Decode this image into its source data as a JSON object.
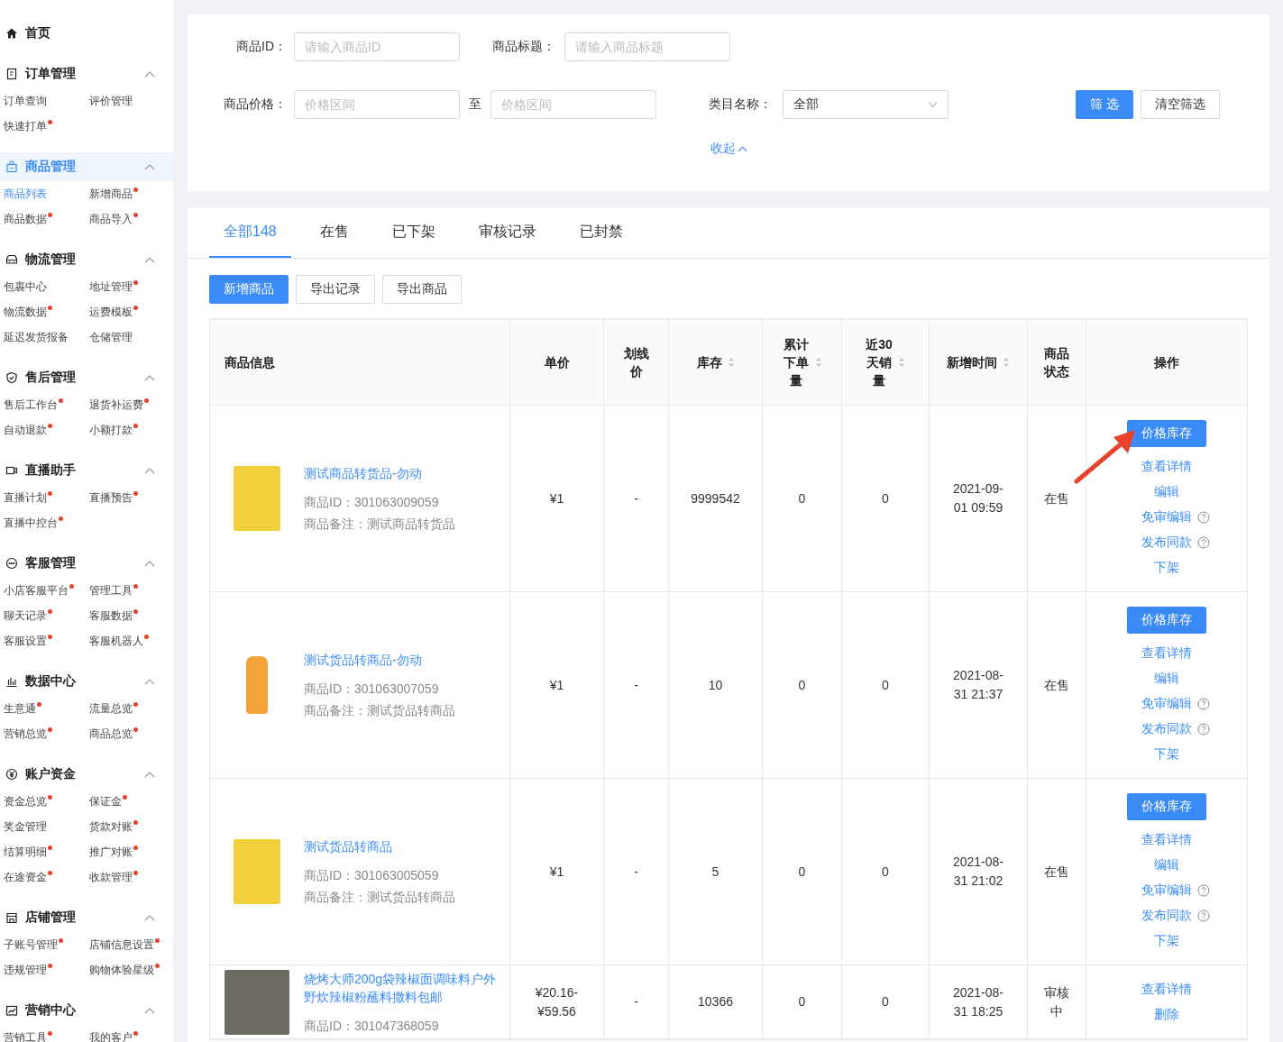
{
  "sidebar": {
    "home": {
      "label": "首页"
    },
    "groups": [
      {
        "title": "订单管理",
        "selected": false,
        "items": [
          {
            "label": "订单查询",
            "dot": false,
            "selected": false
          },
          {
            "label": "评价管理",
            "dot": false,
            "selected": false
          },
          {
            "label": "快速打单",
            "dot": true,
            "selected": false
          }
        ]
      },
      {
        "title": "商品管理",
        "selected": true,
        "items": [
          {
            "label": "商品列表",
            "dot": false,
            "selected": true
          },
          {
            "label": "新增商品",
            "dot": true,
            "selected": false
          },
          {
            "label": "商品数据",
            "dot": true,
            "selected": false
          },
          {
            "label": "商品导入",
            "dot": true,
            "selected": false
          }
        ]
      },
      {
        "title": "物流管理",
        "selected": false,
        "items": [
          {
            "label": "包裹中心",
            "dot": false,
            "selected": false
          },
          {
            "label": "地址管理",
            "dot": true,
            "selected": false
          },
          {
            "label": "物流数据",
            "dot": true,
            "selected": false
          },
          {
            "label": "运费模板",
            "dot": true,
            "selected": false
          },
          {
            "label": "延迟发货报备",
            "dot": false,
            "selected": false
          },
          {
            "label": "仓储管理",
            "dot": false,
            "selected": false
          }
        ]
      },
      {
        "title": "售后管理",
        "selected": false,
        "items": [
          {
            "label": "售后工作台",
            "dot": true,
            "selected": false
          },
          {
            "label": "退货补运费",
            "dot": true,
            "selected": false
          },
          {
            "label": "自动退款",
            "dot": true,
            "selected": false
          },
          {
            "label": "小额打款",
            "dot": true,
            "selected": false
          }
        ]
      },
      {
        "title": "直播助手",
        "selected": false,
        "items": [
          {
            "label": "直播计划",
            "dot": true,
            "selected": false
          },
          {
            "label": "直播预告",
            "dot": true,
            "selected": false
          },
          {
            "label": "直播中控台",
            "dot": true,
            "selected": false
          }
        ]
      },
      {
        "title": "客服管理",
        "selected": false,
        "items": [
          {
            "label": "小店客服平台",
            "dot": true,
            "selected": false
          },
          {
            "label": "管理工具",
            "dot": true,
            "selected": false
          },
          {
            "label": "聊天记录",
            "dot": true,
            "selected": false
          },
          {
            "label": "客服数据",
            "dot": true,
            "selected": false
          },
          {
            "label": "客服设置",
            "dot": true,
            "selected": false
          },
          {
            "label": "客服机器人",
            "dot": true,
            "selected": false
          }
        ]
      },
      {
        "title": "数据中心",
        "selected": false,
        "items": [
          {
            "label": "生意通",
            "dot": true,
            "selected": false
          },
          {
            "label": "流量总览",
            "dot": true,
            "selected": false
          },
          {
            "label": "营销总览",
            "dot": true,
            "selected": false
          },
          {
            "label": "商品总览",
            "dot": true,
            "selected": false
          }
        ]
      },
      {
        "title": "账户资金",
        "selected": false,
        "items": [
          {
            "label": "资金总览",
            "dot": true,
            "selected": false
          },
          {
            "label": "保证金",
            "dot": true,
            "selected": false
          },
          {
            "label": "奖金管理",
            "dot": false,
            "selected": false
          },
          {
            "label": "货款对账",
            "dot": true,
            "selected": false
          },
          {
            "label": "结算明细",
            "dot": true,
            "selected": false
          },
          {
            "label": "推广对账",
            "dot": true,
            "selected": false
          },
          {
            "label": "在途资金",
            "dot": true,
            "selected": false
          },
          {
            "label": "收款管理",
            "dot": true,
            "selected": false
          }
        ]
      },
      {
        "title": "店铺管理",
        "selected": false,
        "items": [
          {
            "label": "子账号管理",
            "dot": true,
            "selected": false
          },
          {
            "label": "店铺信息设置",
            "dot": true,
            "selected": false
          },
          {
            "label": "违规管理",
            "dot": true,
            "selected": false
          },
          {
            "label": "购物体验星级",
            "dot": true,
            "selected": false
          }
        ]
      },
      {
        "title": "营销中心",
        "selected": false,
        "items": [
          {
            "label": "营销工具",
            "dot": true,
            "selected": false
          },
          {
            "label": "我的客户",
            "dot": true,
            "selected": false
          }
        ]
      }
    ]
  },
  "filters": {
    "product_id": {
      "label": "商品ID：",
      "placeholder": "请输入商品ID"
    },
    "product_title": {
      "label": "商品标题：",
      "placeholder": "请输入商品标题"
    },
    "price": {
      "label": "商品价格：",
      "placeholder_from": "价格区间",
      "separator": "至",
      "placeholder_to": "价格区间"
    },
    "category": {
      "label": "类目名称：",
      "value": "全部"
    },
    "filter_button": "筛 选",
    "clear_button": "清空筛选",
    "collapse_link": "收起"
  },
  "tabs": [
    {
      "label": "全部148",
      "selected": true
    },
    {
      "label": "在售",
      "selected": false
    },
    {
      "label": "已下架",
      "selected": false
    },
    {
      "label": "审核记录",
      "selected": false
    },
    {
      "label": "已封禁",
      "selected": false
    }
  ],
  "actions": [
    {
      "label": "新增商品",
      "kind": "primary"
    },
    {
      "label": "导出记录",
      "kind": "default"
    },
    {
      "label": "导出商品",
      "kind": "default"
    }
  ],
  "table": {
    "columns": [
      {
        "label": "商品信息",
        "sortable": false
      },
      {
        "label": "单价",
        "sortable": false
      },
      {
        "label": "划线价",
        "sortable": false
      },
      {
        "label": "库存",
        "sortable": true
      },
      {
        "label": "累计下单量",
        "sortable": true
      },
      {
        "label": "近30天销量",
        "sortable": true
      },
      {
        "label": "新增时间",
        "sortable": true
      },
      {
        "label": "商品状态",
        "sortable": false
      },
      {
        "label": "操作",
        "sortable": false
      }
    ],
    "rows": [
      {
        "kind": "chips",
        "title": "测试商品转货品-勿动",
        "id": "商品ID：301063009059",
        "note": "商品备注：测试商品转货品",
        "price": "¥1",
        "list_price": "-",
        "stock": "9999542",
        "orders": "0",
        "sales_30d": "0",
        "created": "2021-09-01 09:59",
        "status": "在售",
        "operations": [
          {
            "label": "价格库存",
            "kind": "button"
          },
          {
            "label": "查看详情",
            "kind": "link"
          },
          {
            "label": "编辑",
            "kind": "link"
          },
          {
            "label": "免审编辑",
            "kind": "help"
          },
          {
            "label": "发布同款",
            "kind": "help"
          },
          {
            "label": "下架",
            "kind": "link"
          }
        ]
      },
      {
        "kind": "bottle",
        "title": "测试货品转商品-勿动",
        "id": "商品ID：301063007059",
        "note": "商品备注：测试货品转商品",
        "price": "¥1",
        "list_price": "-",
        "stock": "10",
        "orders": "0",
        "sales_30d": "0",
        "created": "2021-08-31 21:37",
        "status": "在售",
        "operations": [
          {
            "label": "价格库存",
            "kind": "button"
          },
          {
            "label": "查看详情",
            "kind": "link"
          },
          {
            "label": "编辑",
            "kind": "link"
          },
          {
            "label": "免审编辑",
            "kind": "help"
          },
          {
            "label": "发布同款",
            "kind": "help"
          },
          {
            "label": "下架",
            "kind": "link"
          }
        ]
      },
      {
        "kind": "chips",
        "title": "测试货品转商品",
        "id": "商品ID：301063005059",
        "note": "商品备注：测试货品转商品",
        "price": "¥1",
        "list_price": "-",
        "stock": "5",
        "orders": "0",
        "sales_30d": "0",
        "created": "2021-08-31 21:02",
        "status": "在售",
        "operations": [
          {
            "label": "价格库存",
            "kind": "button"
          },
          {
            "label": "查看详情",
            "kind": "link"
          },
          {
            "label": "编辑",
            "kind": "link"
          },
          {
            "label": "免审编辑",
            "kind": "help"
          },
          {
            "label": "发布同款",
            "kind": "help"
          },
          {
            "label": "下架",
            "kind": "link"
          }
        ]
      },
      {
        "kind": "photo",
        "title": "烧烤大师200g袋辣椒面调味料户外野炊辣椒粉蘸料撒料包邮",
        "id": "商品ID：301047368059",
        "price": "¥20.16-¥59.56",
        "list_price": "-",
        "stock": "10366",
        "orders": "0",
        "sales_30d": "0",
        "created": "2021-08-31 18:25",
        "status": "审核中",
        "operations": [
          {
            "label": "查看详情",
            "kind": "link"
          },
          {
            "label": "删除",
            "kind": "link"
          }
        ]
      }
    ]
  },
  "annotation": {
    "arrow": true
  }
}
